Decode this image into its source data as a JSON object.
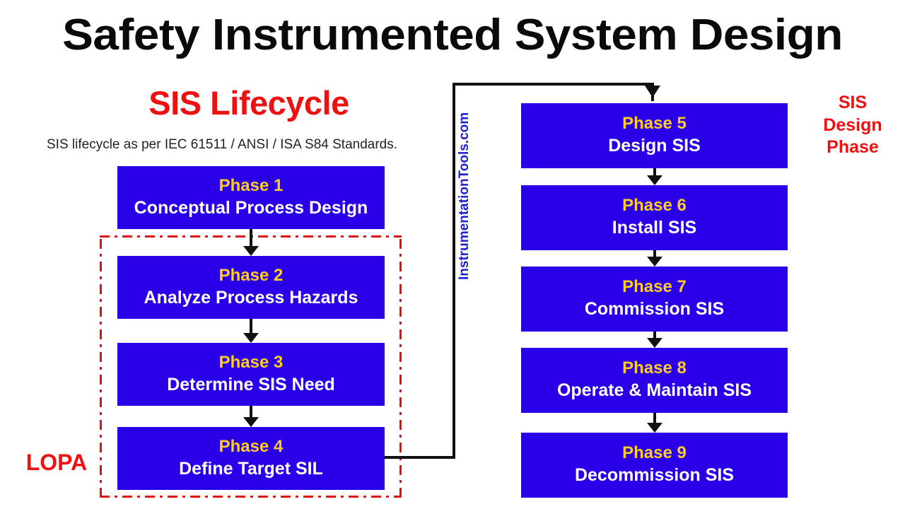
{
  "title": "Safety Instrumented System Design",
  "left_column": {
    "heading": "SIS Lifecycle",
    "subtitle": "SIS lifecycle as per IEC 61511 / ANSI / ISA S84 Standards.",
    "lopa_label": "LOPA"
  },
  "right_column": {
    "label_line1": "SIS",
    "label_line2": "Design",
    "label_line3": "Phase"
  },
  "watermark": "InstrumentationTools.com",
  "phases": [
    {
      "num": "Phase 1",
      "title": "Conceptual Process Design"
    },
    {
      "num": "Phase 2",
      "title": "Analyze Process Hazards"
    },
    {
      "num": "Phase 3",
      "title": "Determine SIS Need"
    },
    {
      "num": "Phase 4",
      "title": "Define Target SIL"
    },
    {
      "num": "Phase 5",
      "title": "Design SIS"
    },
    {
      "num": "Phase 6",
      "title": "Install SIS"
    },
    {
      "num": "Phase 7",
      "title": "Commission SIS"
    },
    {
      "num": "Phase 8",
      "title": "Operate & Maintain SIS"
    },
    {
      "num": "Phase 9",
      "title": "Decommission SIS"
    }
  ],
  "colors": {
    "box_fill": "#2a00e8",
    "phase_number_text": "#ffcc22",
    "phase_title_text": "#ffffff",
    "accent_red": "#ee1111",
    "lopa_border": "#dd1111",
    "watermark_blue": "#2020cc",
    "connector": "#111111",
    "title_text": "#0a0a0a",
    "background": "#ffffff"
  }
}
